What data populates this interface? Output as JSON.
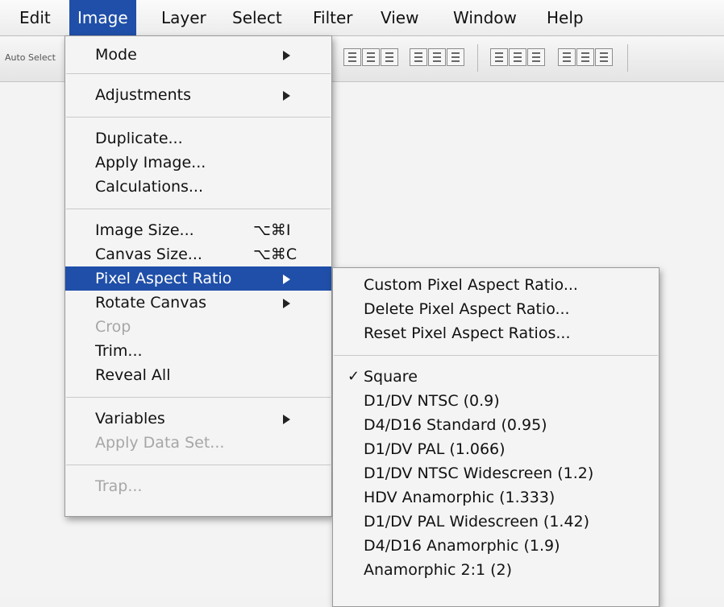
{
  "menubar": [
    {
      "label": "Edit",
      "active": false
    },
    {
      "label": "Image",
      "active": true
    },
    {
      "label": "Layer",
      "active": false
    },
    {
      "label": "Select",
      "active": false
    },
    {
      "label": "Filter",
      "active": false
    },
    {
      "label": "View",
      "active": false
    },
    {
      "label": "Window",
      "active": false
    },
    {
      "label": "Help",
      "active": false
    }
  ],
  "toolbar": {
    "auto_select_label": "Auto Select"
  },
  "image_menu": {
    "mode": {
      "label": "Mode"
    },
    "adjustments": {
      "label": "Adjustments"
    },
    "duplicate": {
      "label": "Duplicate..."
    },
    "apply_image": {
      "label": "Apply Image..."
    },
    "calculations": {
      "label": "Calculations..."
    },
    "image_size": {
      "label": "Image Size...",
      "shortcut": "⌥⌘I"
    },
    "canvas_size": {
      "label": "Canvas Size...",
      "shortcut": "⌥⌘C"
    },
    "pixel_aspect_ratio": {
      "label": "Pixel Aspect Ratio"
    },
    "rotate_canvas": {
      "label": "Rotate Canvas"
    },
    "crop": {
      "label": "Crop"
    },
    "trim": {
      "label": "Trim..."
    },
    "reveal_all": {
      "label": "Reveal All"
    },
    "variables": {
      "label": "Variables"
    },
    "apply_data_set": {
      "label": "Apply Data Set..."
    },
    "trap": {
      "label": "Trap..."
    }
  },
  "par_submenu": {
    "actions": [
      "Custom Pixel Aspect Ratio...",
      "Delete Pixel Aspect Ratio...",
      "Reset Pixel Aspect Ratios..."
    ],
    "check_mark": "✓",
    "ratios": [
      "Square",
      "D1/DV NTSC (0.9)",
      "D4/D16 Standard (0.95)",
      "D1/DV PAL (1.066)",
      "D1/DV NTSC Widescreen (1.2)",
      "HDV Anamorphic (1.333)",
      "D1/DV PAL Widescreen (1.42)",
      "D4/D16 Anamorphic (1.9)",
      "Anamorphic 2:1 (2)"
    ]
  }
}
